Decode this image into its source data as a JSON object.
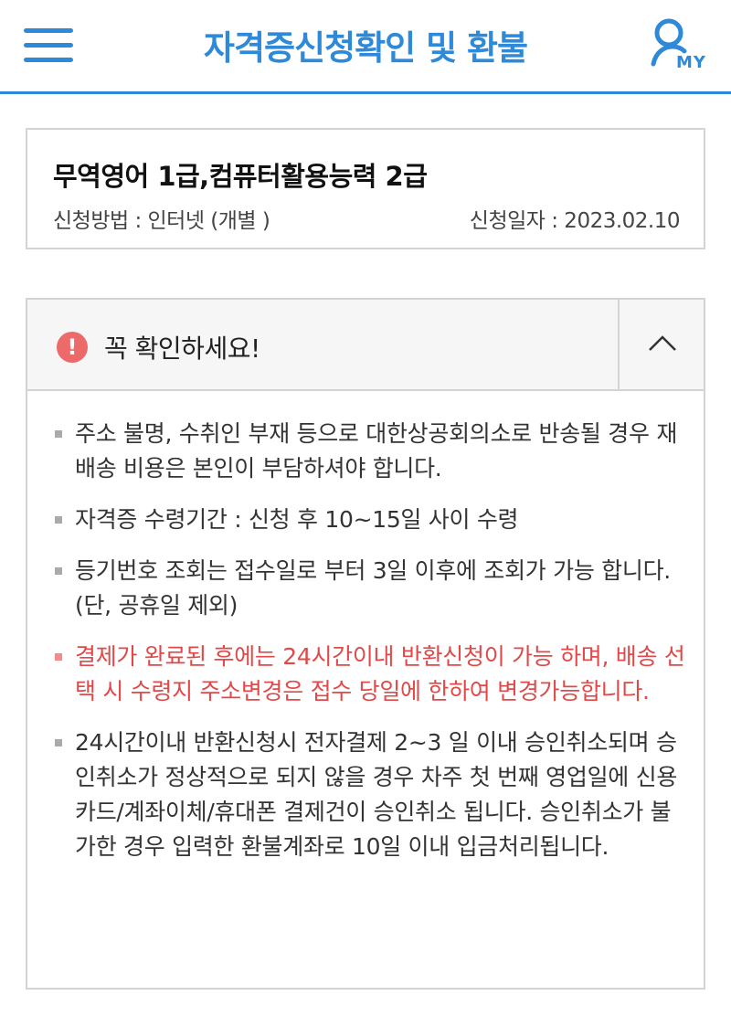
{
  "header": {
    "title": "자격증신청확인 및 환불",
    "menu_icon": "hamburger-menu-icon",
    "my_icon": "user-icon",
    "my_label": "MY",
    "accent_color": "#2e8ad8"
  },
  "certificate": {
    "name": "무역영어 1급,컴퓨터활용능력 2급",
    "method": "신청방법 : 인터넷 (개별 )",
    "date": "신청일자 : 2023.02.10"
  },
  "notice": {
    "icon": "exclamation-icon",
    "title": "꼭 확인하세요!",
    "toggle_icon": "chevron-up-icon",
    "items": [
      {
        "text": "주소 불명, 수취인 부재 등으로 대한상공회의소로 반송될 경우 재배송 비용은 본인이 부담하셔야 합니다."
      },
      {
        "text": "자격증 수령기간 : 신청 후 10~15일 사이 수령"
      },
      {
        "text": "등기번호 조회는 접수일로 부터 3일 이후에 조회가 가능 합니다.(단, 공휴일 제외)"
      },
      {
        "text": "결제가 완료된 후에는 24시간이내 반환신청이 가능 하며, 배송 선택 시 수령지 주소변경은 접수 당일에 한하여 변경가능합니다.",
        "color": "#e14848"
      },
      {
        "text": "24시간이내 반환신청시 전자결제 2~3 일 이내 승인취소되며 승인취소가 정상적으로 되지 않을 경우 차주 첫 번째 영업일에 신용카드/계좌이체/휴대폰 결제건이 승인취소 됩니다. 승인취소가 불가한 경우 입력한 환불계좌로 10일 이내 입금처리됩니다."
      }
    ]
  }
}
